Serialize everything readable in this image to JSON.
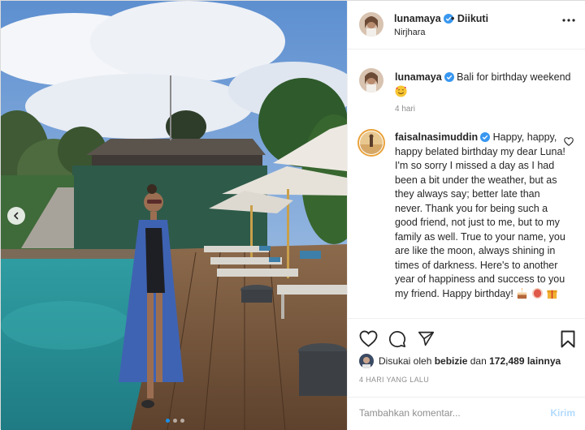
{
  "post": {
    "author": {
      "username": "lunamaya",
      "verified": true,
      "follow_separator": "•",
      "follow_status": "Diikuti",
      "location": "Nirjhara"
    },
    "caption": {
      "username": "lunamaya",
      "text": "Bali for birthday weekend",
      "emoji": "smiling-face-with-hearts",
      "time": "4 hari"
    },
    "comments": [
      {
        "username": "faisalnasimuddin",
        "verified": true,
        "text": "Happy, happy, happy belated birthday my dear Luna! I'm so sorry I missed a day as I had been a bit under the weather, but as they always say; better late than never. Thank you for being such a good friend, not just to me, but to my family as well. True to your name, you are like the moon, always shining in times of darkness. Here's to another year of happiness and success to you my friend. Happy birthday!"
      }
    ],
    "likes": {
      "prefix": "Disukai oleh",
      "first_user": "bebizie",
      "connector": "dan",
      "count_text": "172,489 lainnya"
    },
    "date": "4 HARI YANG LALU",
    "comment_box": {
      "placeholder": "Tambahkan komentar...",
      "post_label": "Kirim"
    },
    "carousel": {
      "current": 1,
      "total": 3
    },
    "colors": {
      "verified": "#3897f0",
      "link_disabled": "#b3dbff",
      "secondary_text": "#8e8e8e",
      "active_dot": "#1a8fe6"
    },
    "icons": [
      "chevron-left-icon",
      "more-icon",
      "verified-icon",
      "heart-icon",
      "comment-icon",
      "share-icon",
      "bookmark-icon"
    ]
  }
}
